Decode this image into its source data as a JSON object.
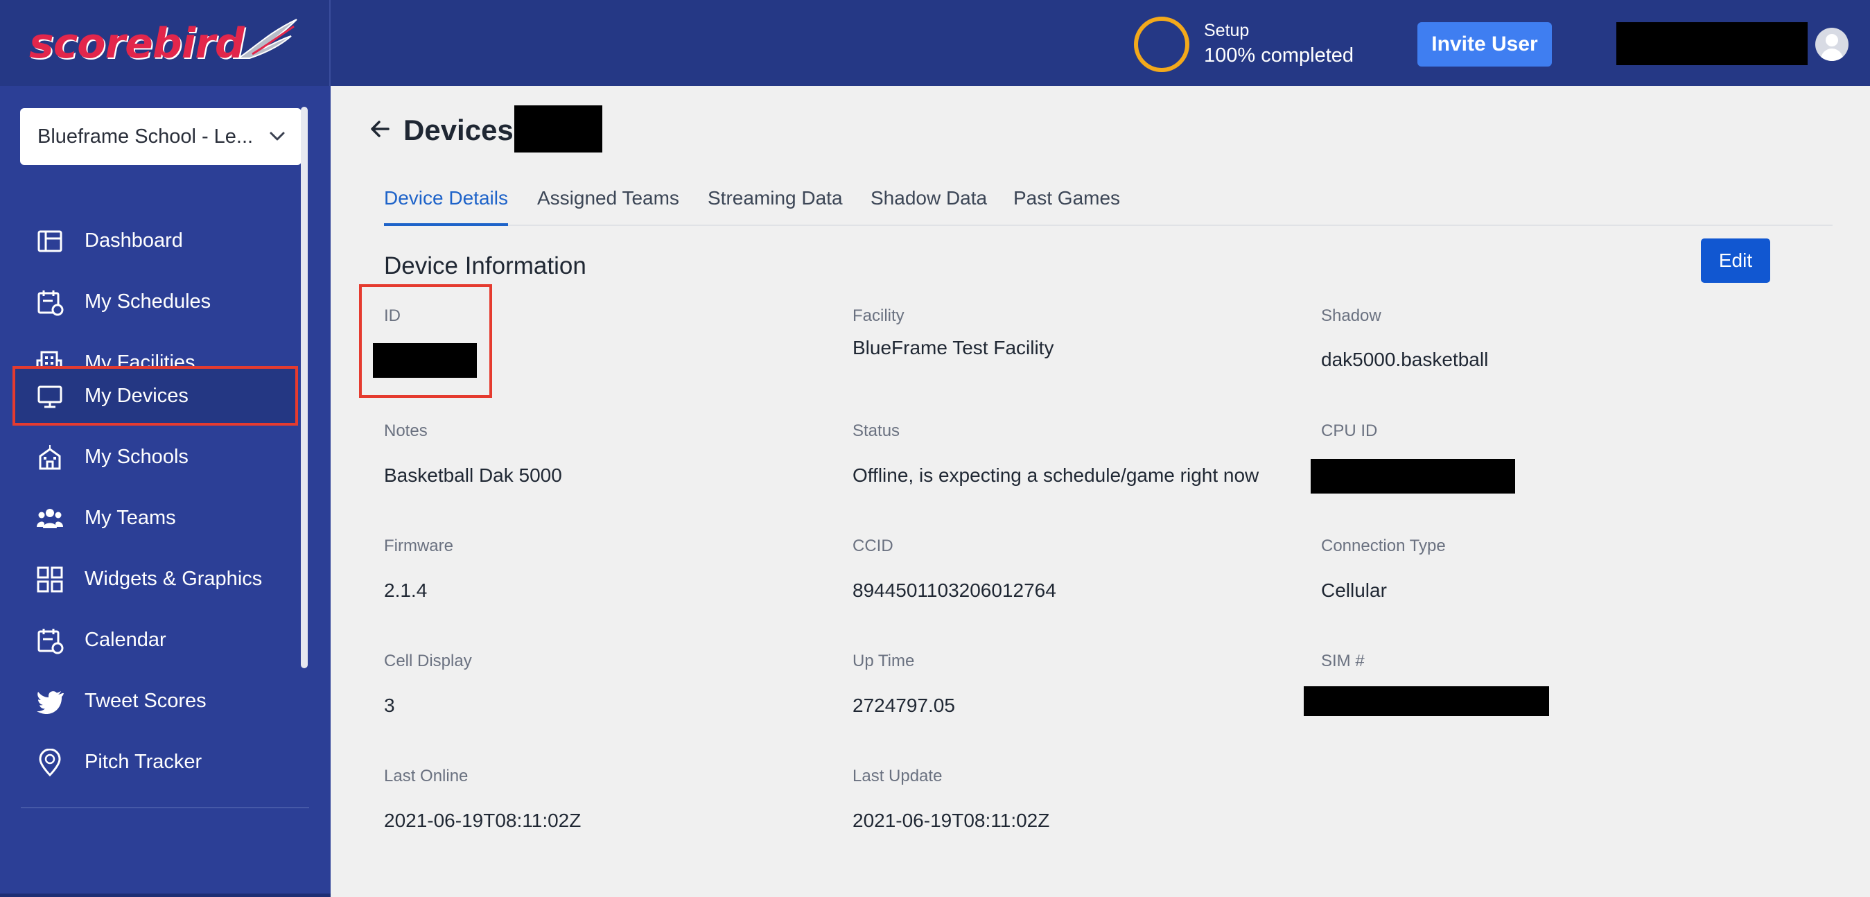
{
  "header": {
    "logo_text": "scorebird",
    "setup_label": "Setup",
    "setup_progress": "100% completed",
    "invite_label": "Invite User"
  },
  "sidebar": {
    "school_select": "Blueframe School - Le...",
    "items": [
      {
        "label": "Dashboard",
        "icon": "dashboard-icon"
      },
      {
        "label": "My Schedules",
        "icon": "schedule-icon"
      },
      {
        "label": "My Facilities",
        "icon": "building-icon"
      },
      {
        "label": "My Devices",
        "icon": "monitor-icon",
        "active": true
      },
      {
        "label": "My Schools",
        "icon": "school-icon"
      },
      {
        "label": "My Teams",
        "icon": "team-icon"
      },
      {
        "label": "Widgets & Graphics",
        "icon": "widgets-icon"
      },
      {
        "label": "Calendar",
        "icon": "calendar-icon"
      },
      {
        "label": "Tweet Scores",
        "icon": "twitter-icon"
      },
      {
        "label": "Pitch Tracker",
        "icon": "location-pin-icon"
      }
    ]
  },
  "page": {
    "title": "Devices",
    "tabs": [
      "Device Details",
      "Assigned Teams",
      "Streaming Data",
      "Shadow Data",
      "Past Games"
    ],
    "active_tab": "Device Details",
    "section_title": "Device Information",
    "edit_label": "Edit"
  },
  "fields": {
    "id": {
      "label": "ID"
    },
    "facility": {
      "label": "Facility",
      "value": "BlueFrame Test Facility"
    },
    "shadow": {
      "label": "Shadow",
      "value": "dak5000.basketball"
    },
    "notes": {
      "label": "Notes",
      "value": "Basketball Dak 5000"
    },
    "status": {
      "label": "Status",
      "value": "Offline, is expecting a schedule/game right now"
    },
    "cpu_id": {
      "label": "CPU ID"
    },
    "firmware": {
      "label": "Firmware",
      "value": "2.1.4"
    },
    "ccid": {
      "label": "CCID",
      "value": "8944501103206012764"
    },
    "connection_type": {
      "label": "Connection Type",
      "value": "Cellular"
    },
    "cell_display": {
      "label": "Cell Display",
      "value": "3"
    },
    "up_time": {
      "label": "Up Time",
      "value": "2724797.05"
    },
    "sim": {
      "label": "SIM #"
    },
    "last_online": {
      "label": "Last Online",
      "value": "2021-06-19T08:11:02Z"
    },
    "last_update": {
      "label": "Last Update",
      "value": "2021-06-19T08:11:02Z"
    }
  },
  "colors": {
    "topbar": "#253885",
    "sidebar": "#2c3f96",
    "accent": "#1157d1",
    "highlight": "#e53b2f",
    "setup_ring": "#f3a91b"
  }
}
